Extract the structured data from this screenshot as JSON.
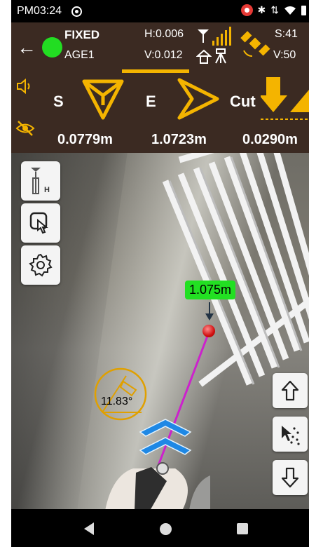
{
  "status_bar": {
    "time": "PM03:24",
    "icons": [
      "screen-record-icon",
      "cast-icon",
      "bluetooth-icon",
      "data-arrows-icon",
      "wifi-icon",
      "battery-icon"
    ]
  },
  "gnss": {
    "fix_status": "FIXED",
    "age": "AGE1",
    "h_precision": "H:0.006",
    "v_precision": "V:0.012",
    "satellites_used": "S:41",
    "satellites_visible": "V:50",
    "fix_color": "#22dd22"
  },
  "stakeout": {
    "direction_1_label": "S",
    "direction_1_value": "0.0779m",
    "direction_2_label": "E",
    "direction_2_value": "1.0723m",
    "cut_fill_label": "Cut",
    "cut_fill_value": "0.0290m",
    "accent_color": "#f4b400"
  },
  "ar_view": {
    "distance_label": "1.075m",
    "tilt_angle": "11.83°",
    "target_color": "#d01010",
    "guide_line_color": "#cc22cc",
    "chevron_color": "#1e88e5"
  },
  "left_tools": [
    "antenna-height-button",
    "touch-mode-button",
    "settings-button"
  ],
  "right_tools": [
    "up-button",
    "point-cloud-button",
    "down-button"
  ],
  "nav_bar": [
    "back",
    "home",
    "recents"
  ]
}
